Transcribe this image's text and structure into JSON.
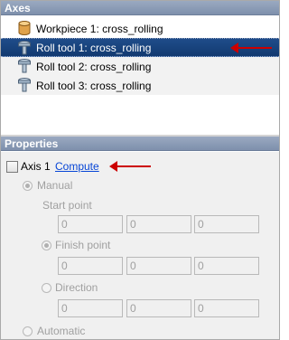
{
  "axes": {
    "header": "Axes",
    "items": [
      {
        "label": "Workpiece 1: cross_rolling",
        "icon": "workpiece-icon"
      },
      {
        "label": "Roll tool 1: cross_rolling",
        "icon": "roll-tool-icon",
        "selected": true
      },
      {
        "label": "Roll tool 2: cross_rolling",
        "icon": "roll-tool-icon"
      },
      {
        "label": "Roll tool 3: cross_rolling",
        "icon": "roll-tool-icon"
      }
    ]
  },
  "properties": {
    "header": "Properties",
    "axis_checkbox_label": "Axis 1",
    "compute_link": "Compute",
    "manual_label": "Manual",
    "start_point_label": "Start point",
    "start_point": [
      "0",
      "0",
      "0"
    ],
    "finish_point_label": "Finish point",
    "finish_point": [
      "0",
      "0",
      "0"
    ],
    "direction_label": "Direction",
    "direction": [
      "0",
      "0",
      "0"
    ],
    "automatic_label": "Automatic"
  },
  "colors": {
    "header_bg": "#8a9bb6",
    "selection_bg": "#1a4480",
    "link": "#0645d6",
    "annotation_arrow": "#cc0000"
  }
}
